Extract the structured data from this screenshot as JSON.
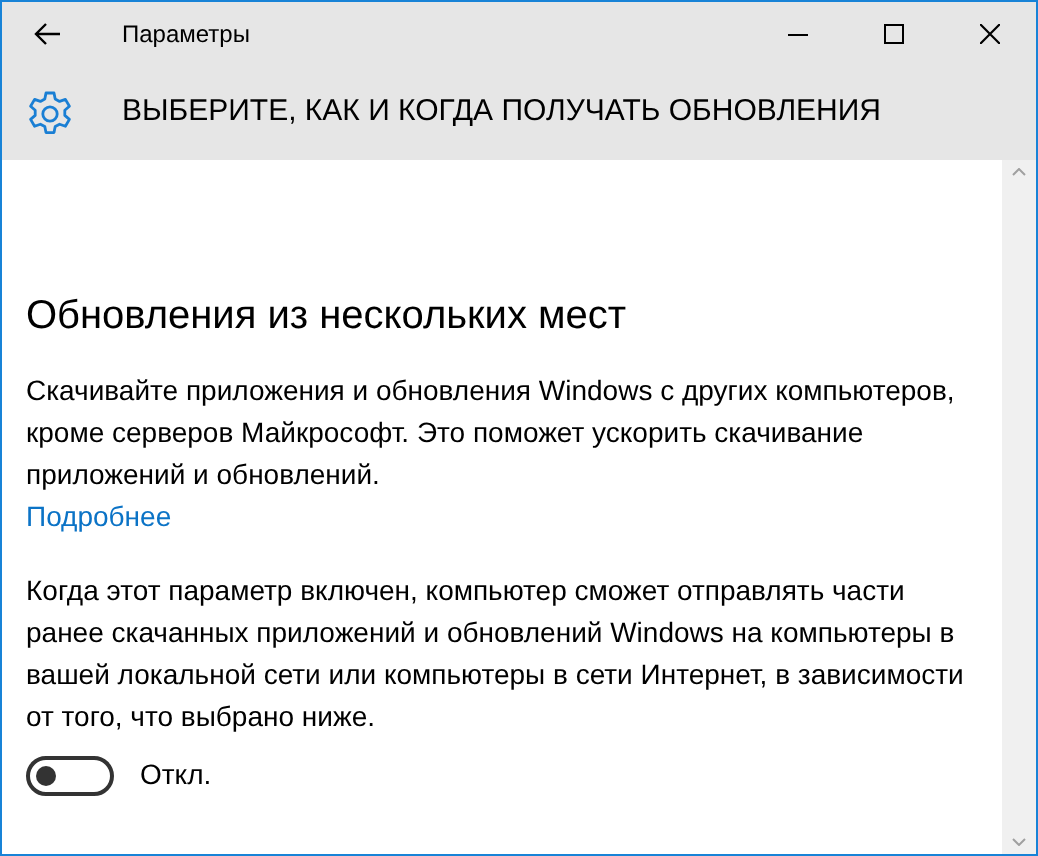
{
  "window": {
    "title": "Параметры"
  },
  "header": {
    "title": "ВЫБЕРИТЕ, КАК И КОГДА ПОЛУЧАТЬ ОБНОВЛЕНИЯ"
  },
  "section": {
    "title": "Обновления из нескольких мест",
    "description": "Скачивайте приложения и обновления Windows с других компьютеров, кроме серверов Майкрософт. Это поможет ускорить скачивание приложений и обновлений.",
    "link": "Подробнее",
    "note": "Когда этот параметр включен, компьютер сможет отправлять части ранее скачанных приложений и обновлений Windows на компьютеры в вашей локальной сети или компьютеры в сети Интернет, в зависимости от того, что выбрано ниже.",
    "toggle": {
      "on": false,
      "label": "Откл."
    }
  }
}
